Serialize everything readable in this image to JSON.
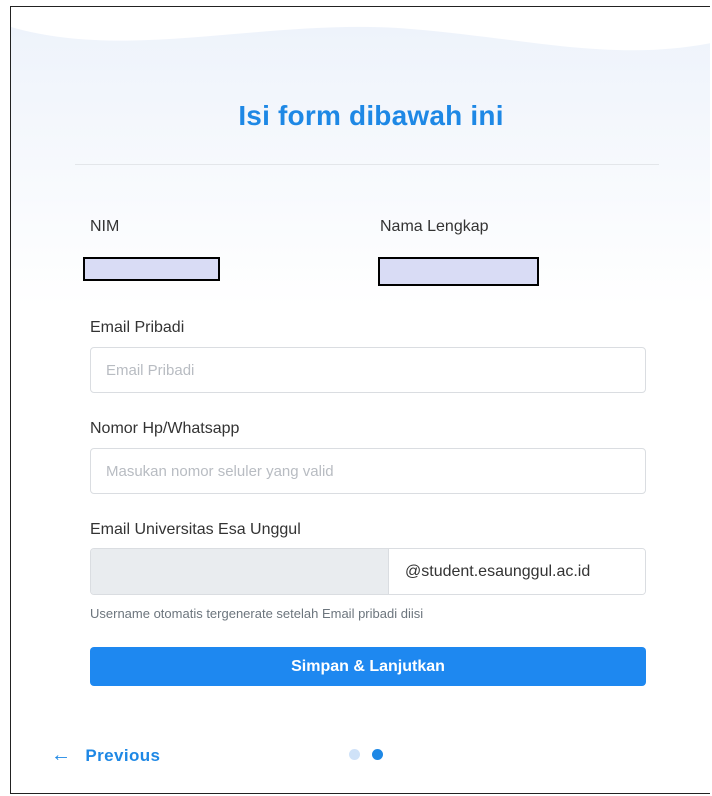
{
  "form": {
    "title": "Isi form dibawah ini",
    "nim_label": "NIM",
    "nama_label": "Nama Lengkap",
    "email_pribadi_label": "Email Pribadi",
    "email_pribadi_placeholder": "Email Pribadi",
    "nomor_hp_label": "Nomor Hp/Whatsapp",
    "nomor_hp_placeholder": "Masukan nomor seluler yang valid",
    "email_univ_label": "Email Universitas Esa Unggul",
    "email_univ_suffix": "@student.esaunggul.ac.id",
    "help_text": "Username otomatis tergenerate setelah Email pribadi diisi",
    "submit_label": "Simpan & Lanjutkan"
  },
  "nav": {
    "previous_label": "Previous",
    "previous_icon": "arrow-left-icon",
    "steps_total": 2,
    "steps_current": 2
  },
  "colors": {
    "accent": "#1e88e5",
    "button": "#1e88f0",
    "dot_inactive": "#cfe2f8",
    "readonly_bg": "#e9ecef"
  }
}
